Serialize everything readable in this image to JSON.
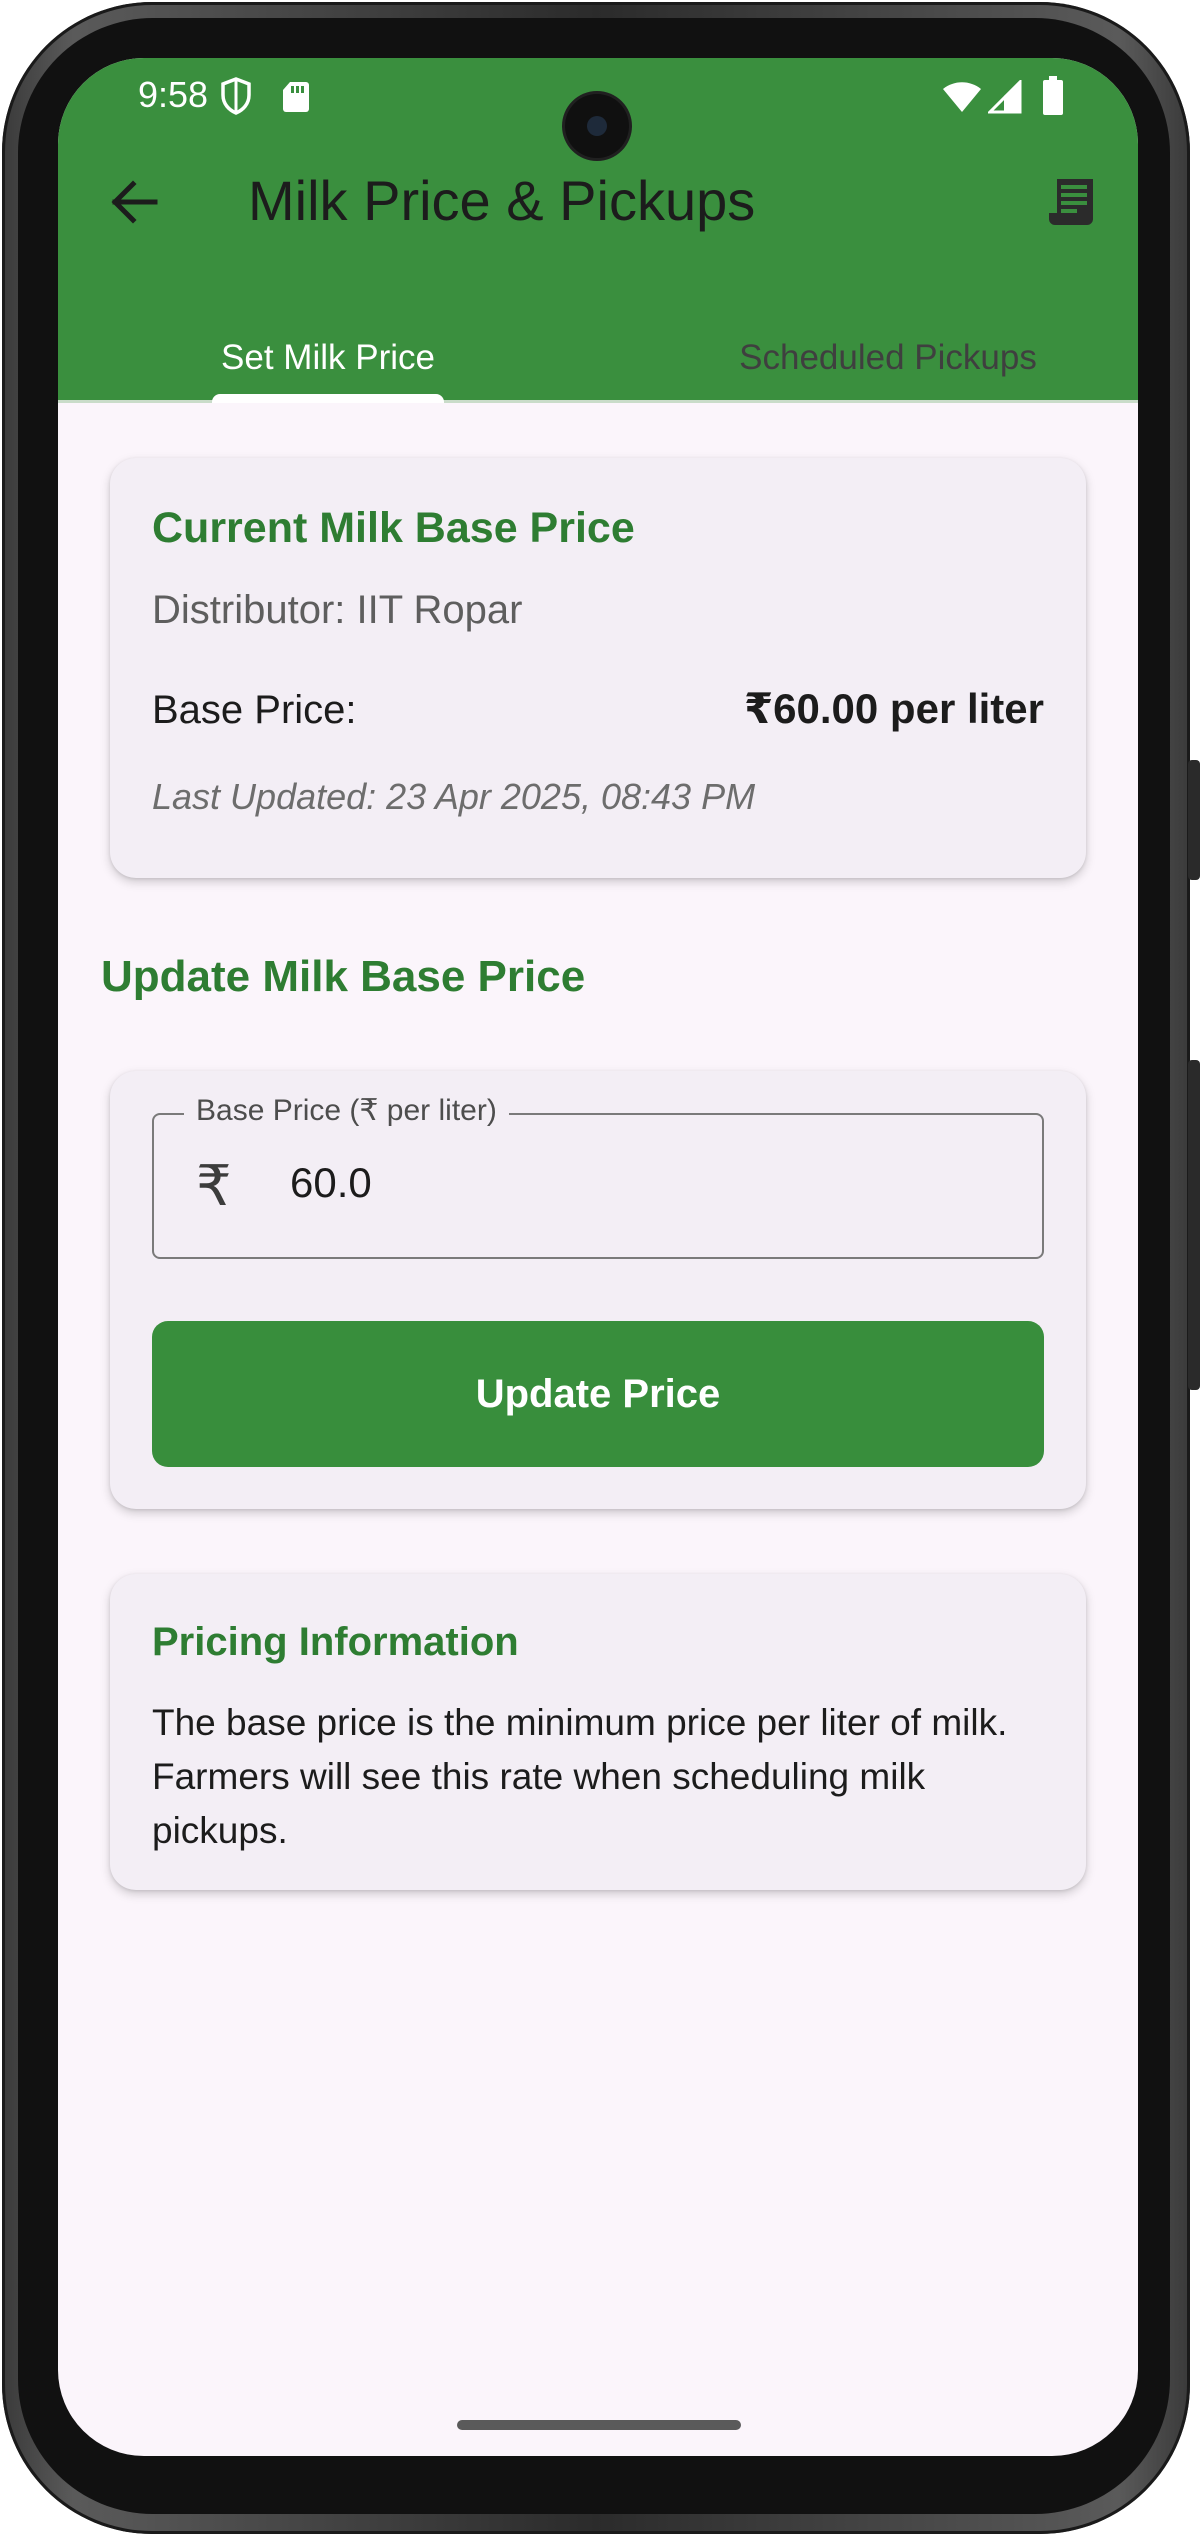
{
  "status_bar": {
    "time": "9:58",
    "icons": [
      "shield-icon",
      "sd-card-icon",
      "wifi-icon",
      "signal-icon",
      "battery-icon"
    ]
  },
  "app_bar": {
    "title": "Milk Price & Pickups",
    "back_icon": "arrow-back-icon",
    "action_icon": "receipt-icon",
    "color": "#3a8f3e"
  },
  "tabs": [
    {
      "label": "Set Milk Price",
      "active": true
    },
    {
      "label": "Scheduled Pickups",
      "active": false
    }
  ],
  "current_price_card": {
    "title": "Current Milk Base Price",
    "distributor": "Distributor: IIT Ropar",
    "base_price_label": "Base Price:",
    "base_price_value": "₹60.00 per liter",
    "last_updated": "Last Updated: 23 Apr 2025, 08:43 PM"
  },
  "update_section": {
    "heading": "Update Milk Base Price",
    "input_label": "Base Price (₹ per liter)",
    "input_prefix": "₹",
    "input_value": "60.0",
    "button_label": "Update Price"
  },
  "info_card": {
    "title": "Pricing Information",
    "text": "The base price is the minimum price per liter of milk. Farmers will see this rate when scheduling milk pickups."
  },
  "colors": {
    "accent_green": "#2e7d32",
    "button_green": "#388e3c",
    "screen_background": "#fbf5fb",
    "card_background": "#f3eef5"
  }
}
